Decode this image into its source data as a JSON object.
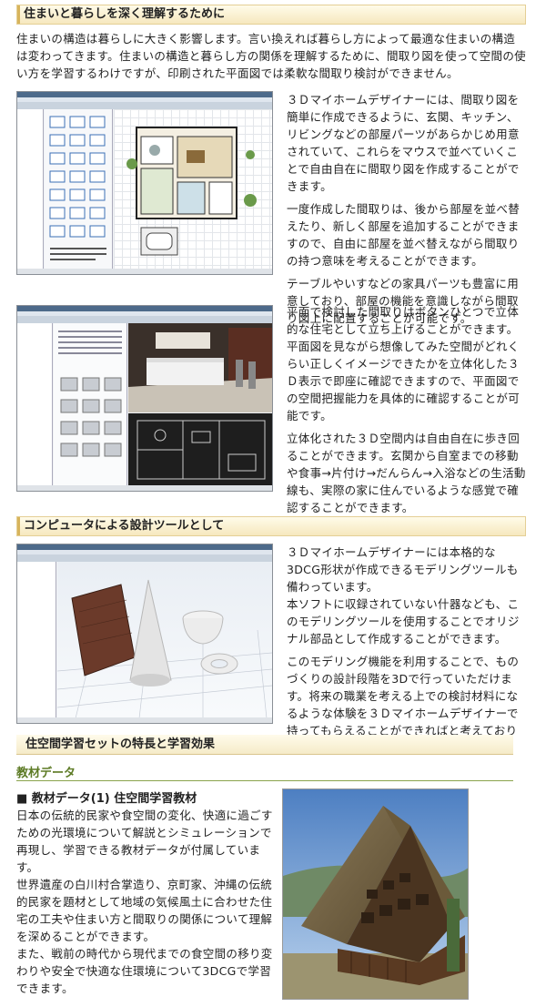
{
  "section1": {
    "title": "住まいと暮らしを深く理解するために",
    "intro": "住まいの構造は暮らしに大きく影響します。言い換えれば暮らし方によって最適な住まいの構造は変わってきます。住まいの構造と暮らし方の関係を理解するために、間取り図を使って空間の使い方を学習するわけですが、印刷された平面図では柔軟な間取り検討ができません。",
    "paragraphs_a": [
      "３Ｄマイホームデザイナーには、間取り図を簡単に作成できるように、玄関、キッチン、リビングなどの部屋パーツがあらかじめ用意されていて、これらをマウスで並べていくことで自由自在に間取り図を作成することができます。",
      "一度作成した間取りは、後から部屋を並べ替えたり、新しく部屋を追加することができますので、自由に部屋を並べ替えながら間取りの持つ意味を考えることができます。",
      "テーブルやいすなどの家具パーツも豊富に用意しており、部屋の機能を意識しながら間取り図上に配置することが可能です。"
    ],
    "paragraphs_b": [
      "平面で検討した間取りはボタンひとつで立体的な住宅として立ち上げることができます。平面図を見ながら想像してみた空間がどれくらい正しくイメージできたかを立体化した３Ｄ表示で即座に確認できますので、平面図での空間把握能力を具体的に確認することが可能です。",
      "立体化された３Ｄ空間内は自由自在に歩き回ることができます。玄関から自室までの移動や食事→片付け→だんらん→入浴などの生活動線も、実際の家に住んでいるような感覚で確認することができます。"
    ]
  },
  "section2": {
    "title": "コンピュータによる設計ツールとして",
    "paragraphs": [
      "３Ｄマイホームデザイナーには本格的な3DCG形状が作成できるモデリングツールも備わっています。\n本ソフトに収録されていない什器なども、このモデリングツールを使用することでオリジナル部品として作成することができます。",
      "このモデリング機能を利用することで、ものづくりの設計段階を3Dで行っていただけます。将来の職業を考える上での検討材料になるような体験を３Ｄマイホームデザイナーで持ってもらえることができればと考えております。"
    ]
  },
  "section3": {
    "title": "住空間学習セットの特長と学習効果",
    "subheading": "教材データ",
    "item_title": "■ 教材データ(1) 住空間学習教材",
    "paragraphs": [
      "日本の伝統的民家や食空間の変化、快適に過ごすための光環境について解説とシミュレーションで再現し、学習できる教材データが付属しています。",
      "世界遺産の白川村合掌造り、京町家、沖縄の伝統的民家を題材として地域の気候風土に合わせた住宅の工夫や住まい方と間取りの関係について理解を深めることができます。",
      "また、戦前の時代から現代までの食空間の移り変わりや安全で快適な住環境について3DCGで学習できます。"
    ]
  }
}
